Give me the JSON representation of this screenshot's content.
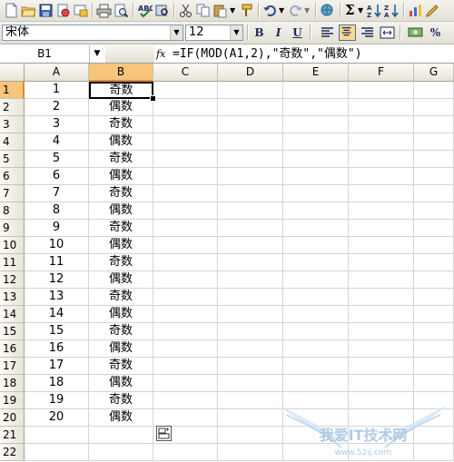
{
  "font_box": {
    "value": "宋体"
  },
  "size_box": {
    "value": "12"
  },
  "format_buttons": {
    "bold": "B",
    "italic": "I",
    "underline": "U",
    "percent": "%"
  },
  "name_box": {
    "value": "B1"
  },
  "formula_bar": {
    "fx": "fx",
    "formula": "=IF(MOD(A1,2),\"奇数\",\"偶数\")"
  },
  "columns": [
    "A",
    "B",
    "C",
    "D",
    "E",
    "F",
    "G"
  ],
  "rows": [
    {
      "num": "1",
      "a": "1",
      "b": "奇数"
    },
    {
      "num": "2",
      "a": "2",
      "b": "偶数"
    },
    {
      "num": "3",
      "a": "3",
      "b": "奇数"
    },
    {
      "num": "4",
      "a": "4",
      "b": "偶数"
    },
    {
      "num": "5",
      "a": "5",
      "b": "奇数"
    },
    {
      "num": "6",
      "a": "6",
      "b": "偶数"
    },
    {
      "num": "7",
      "a": "7",
      "b": "奇数"
    },
    {
      "num": "8",
      "a": "8",
      "b": "偶数"
    },
    {
      "num": "9",
      "a": "9",
      "b": "奇数"
    },
    {
      "num": "10",
      "a": "10",
      "b": "偶数"
    },
    {
      "num": "11",
      "a": "11",
      "b": "奇数"
    },
    {
      "num": "12",
      "a": "12",
      "b": "偶数"
    },
    {
      "num": "13",
      "a": "13",
      "b": "奇数"
    },
    {
      "num": "14",
      "a": "14",
      "b": "偶数"
    },
    {
      "num": "15",
      "a": "15",
      "b": "奇数"
    },
    {
      "num": "16",
      "a": "16",
      "b": "偶数"
    },
    {
      "num": "17",
      "a": "17",
      "b": "奇数"
    },
    {
      "num": "18",
      "a": "18",
      "b": "偶数"
    },
    {
      "num": "19",
      "a": "19",
      "b": "奇数"
    },
    {
      "num": "20",
      "a": "20",
      "b": "偶数"
    },
    {
      "num": "21",
      "a": "",
      "b": ""
    },
    {
      "num": "22",
      "a": "",
      "b": ""
    }
  ],
  "watermark": {
    "title": "我爱IT技术网",
    "url": "www.52ij.com"
  },
  "colors": {
    "selection_header": "#f7c57b",
    "active_button": "#f9d98e",
    "grid_line": "#d4d4d4"
  }
}
